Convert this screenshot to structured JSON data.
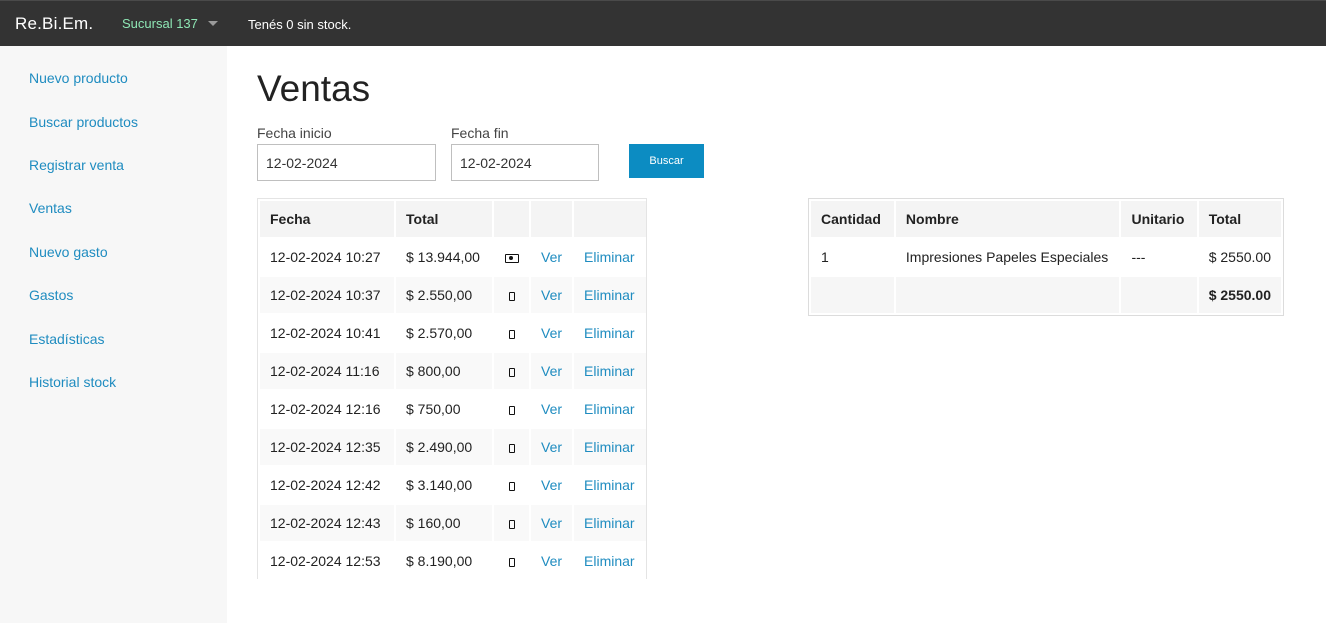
{
  "header": {
    "brand": "Re.Bi.Em.",
    "branch": "Sucursal 137",
    "stock_message": "Tenés 0 sin stock."
  },
  "sidebar": {
    "items": [
      {
        "label": "Nuevo producto"
      },
      {
        "label": "Buscar productos"
      },
      {
        "label": "Registrar venta"
      },
      {
        "label": "Ventas"
      },
      {
        "label": "Nuevo gasto"
      },
      {
        "label": "Gastos"
      },
      {
        "label": "Estadísticas"
      },
      {
        "label": "Historial stock"
      }
    ]
  },
  "main": {
    "title": "Ventas",
    "filters": {
      "start_label": "Fecha inicio",
      "start_value": "12-02-2024",
      "end_label": "Fecha fin",
      "end_value": "12-02-2024",
      "search_button": "Buscar"
    },
    "sales_table": {
      "headers": [
        "Fecha",
        "Total"
      ],
      "view_label": "Ver",
      "delete_label": "Eliminar",
      "rows": [
        {
          "date": "12-02-2024 10:27",
          "total": "$ 13.944,00",
          "payment_icon": "cash-icon"
        },
        {
          "date": "12-02-2024 10:37",
          "total": "$ 2.550,00",
          "payment_icon": "mobile-phone-icon"
        },
        {
          "date": "12-02-2024 10:41",
          "total": "$ 2.570,00",
          "payment_icon": "mobile-phone-icon"
        },
        {
          "date": "12-02-2024 11:16",
          "total": "$ 800,00",
          "payment_icon": "mobile-phone-icon"
        },
        {
          "date": "12-02-2024 12:16",
          "total": "$ 750,00",
          "payment_icon": "mobile-phone-icon"
        },
        {
          "date": "12-02-2024 12:35",
          "total": "$ 2.490,00",
          "payment_icon": "mobile-phone-icon"
        },
        {
          "date": "12-02-2024 12:42",
          "total": "$ 3.140,00",
          "payment_icon": "mobile-phone-icon"
        },
        {
          "date": "12-02-2024 12:43",
          "total": "$ 160,00",
          "payment_icon": "mobile-phone-icon"
        },
        {
          "date": "12-02-2024 12:53",
          "total": "$ 8.190,00",
          "payment_icon": "mobile-phone-icon"
        }
      ]
    },
    "detail_table": {
      "headers": [
        "Cantidad",
        "Nombre",
        "Unitario",
        "Total"
      ],
      "rows": [
        {
          "qty": "1",
          "name": "Impresiones Papeles Especiales",
          "unit": "---",
          "total": "$ 2550.00"
        }
      ],
      "grand_total": "$ 2550.00"
    }
  },
  "colors": {
    "topbar": "#333333",
    "link": "#1f8cc0",
    "button": "#0c8cc2",
    "branch_text": "#8ee6b4",
    "sidebar_bg": "#f7f7f7"
  }
}
